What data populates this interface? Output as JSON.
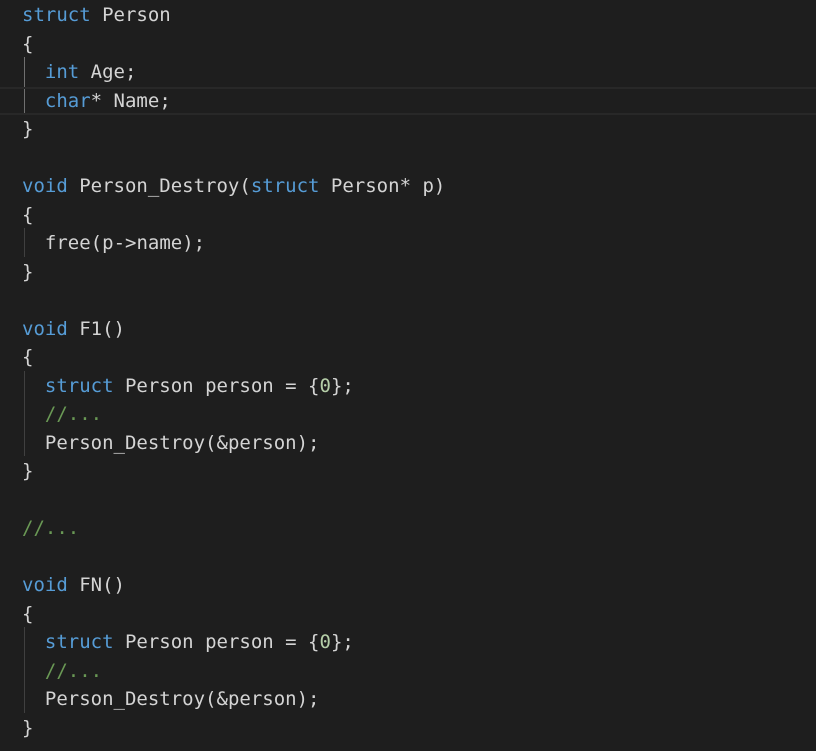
{
  "editor": {
    "lines": [
      "struct Person",
      "{",
      "  int Age;",
      "  char* Name;",
      "}",
      "",
      "void Person_Destroy(struct Person* p)",
      "{",
      "  free(p->name);",
      "}",
      "",
      "void F1()",
      "{",
      "  struct Person person = {0};",
      "  //...",
      "  Person_Destroy(&person);",
      "}",
      "",
      "//...",
      "",
      "void FN()",
      "{",
      "  struct Person person = {0};",
      "  //...",
      "  Person_Destroy(&person);",
      "}"
    ],
    "current_line_index": 3,
    "colors": {
      "background": "#1e1e1e",
      "keyword": "#569cd6",
      "plain": "#d4d4d4",
      "comment": "#6a9955",
      "indent_guide": "#404040",
      "current_line_border": "#282828"
    }
  }
}
